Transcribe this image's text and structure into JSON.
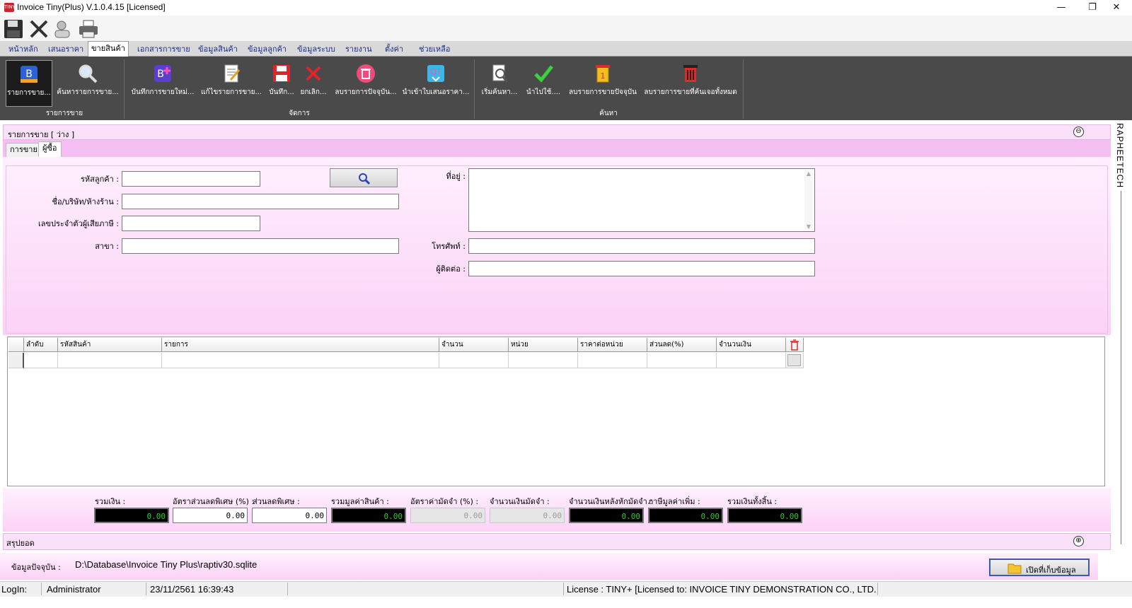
{
  "window": {
    "app_icon_text": "TINY",
    "title": "Invoice Tiny(Plus)  V.1.0.4.15 [Licensed]",
    "minimize": "—",
    "restore": "❐",
    "close": "✕"
  },
  "quick_toolbar": [
    "save-icon",
    "cancel-icon",
    "users-icon",
    "printer-icon"
  ],
  "menu_tabs": [
    "หน้าหลัก",
    "เสนอราคา",
    "ขายสินค้า",
    "เอกสารการขาย",
    "ข้อมูลสินค้า",
    "ข้อมูลลูกค้า",
    "ข้อมูลระบบ",
    "รายงาน",
    "ตั้งค่า",
    "ช่วยเหลือ"
  ],
  "ribbon": {
    "buttons": [
      {
        "label": "รายการขาย...",
        "icon": "sales-list-icon"
      },
      {
        "label": "ค้นหารายการขาย...",
        "icon": "magnifier-icon"
      },
      {
        "label": "บันทึกการขายใหม่...",
        "icon": "new-sale-icon"
      },
      {
        "label": "แก้ไขรายการขาย...",
        "icon": "edit-document-icon"
      },
      {
        "label": "บันทึก...",
        "icon": "save-icon"
      },
      {
        "label": "ยกเลิก...",
        "icon": "cancel-icon"
      },
      {
        "label": "ลบรายการปัจจุบัน...",
        "icon": "delete-icon"
      },
      {
        "label": "นำเข้าใบเสนอราคา...",
        "icon": "import-quotation-icon"
      },
      {
        "label": "เริ่มค้นหา...",
        "icon": "search-document-icon"
      },
      {
        "label": "นำไปใช้....",
        "icon": "checkmark-icon"
      },
      {
        "label": "ลบรายการขายปัจจุบัน",
        "icon": "trash-one-icon"
      },
      {
        "label": "ลบรายการขายที่ค้นเจอทั้งหมด",
        "icon": "trash-all-icon"
      }
    ],
    "groups": [
      "รายการขาย",
      "จัดการ",
      "ค้นหา"
    ]
  },
  "panel": {
    "header": "รายการขาย [ ว่าง ]",
    "collapse_icon": "⊖",
    "subtabs": [
      "การขาย",
      "ผู้ซื้อ"
    ]
  },
  "form": {
    "customer_code_label": "รหัสลูกค้า :",
    "customer_code_value": "",
    "company_label": "ชื่อ/บริษัท/ห้างร้าน :",
    "company_value": "",
    "taxid_label": "เลขประจำตัวผู้เสียภาษี :",
    "taxid_value": "",
    "branch_label": "สาขา :",
    "branch_value": "",
    "address_label": "ที่อยู่ :",
    "address_value": "",
    "phone_label": "โทรศัพท์ :",
    "phone_value": "",
    "contact_label": "ผู้ติดต่อ :",
    "contact_value": ""
  },
  "grid": {
    "columns": [
      "ลำดับ",
      "รหัสสินค้า",
      "รายการ",
      "จำนวน",
      "หน่วย",
      "ราคาต่อหน่วย",
      "ส่วนลด(%)",
      "จำนวนเงิน"
    ],
    "rows": []
  },
  "totals": [
    {
      "label": "รวมเงิน :",
      "value": "0.00",
      "style": "black"
    },
    {
      "label": "อัตราส่วนลดพิเศษ (%) :",
      "value": "0.00",
      "style": "white"
    },
    {
      "label": "ส่วนลดพิเศษ :",
      "value": "0.00",
      "style": "white"
    },
    {
      "label": "รวมมูลค่าสินค้า :",
      "value": "0.00",
      "style": "black"
    },
    {
      "label": "อัตราค่ามัดจำ (%) :",
      "value": "0.00",
      "style": "grey"
    },
    {
      "label": "จำนวนเงินมัดจำ :",
      "value": "0.00",
      "style": "grey"
    },
    {
      "label": "จำนวนเงินหลังหักมัดจำ :",
      "value": "0.00",
      "style": "black"
    },
    {
      "label": "ภาษีมูลค่าเพิ่ม :",
      "value": "0.00",
      "style": "black"
    },
    {
      "label": "รวมเงินทั้งสิ้น :",
      "value": "0.00",
      "style": "black"
    }
  ],
  "summary": {
    "label": "สรุปยอด",
    "expand_icon": "⊕"
  },
  "database": {
    "label": "ข้อมูลปัจจุบัน :",
    "path": "D:\\Database\\Invoice Tiny Plus\\raptiv30.sqlite",
    "open_button": "เปิดที่เก็บข้อมูล"
  },
  "status": {
    "login_label": "LogIn:",
    "user": "Administrator",
    "datetime": "23/11/2561 16:39:43",
    "license": "License : TINY+ [Licensed to: INVOICE TINY DEMONSTRATION CO., LTD."
  },
  "sidebar_text": "RAPHEETECH",
  "colors": {
    "ribbon": "#4a4a4a",
    "pink": "#fcd6fa",
    "accent_text": "#1a2d8a",
    "total_digits": "#1fd31f"
  }
}
